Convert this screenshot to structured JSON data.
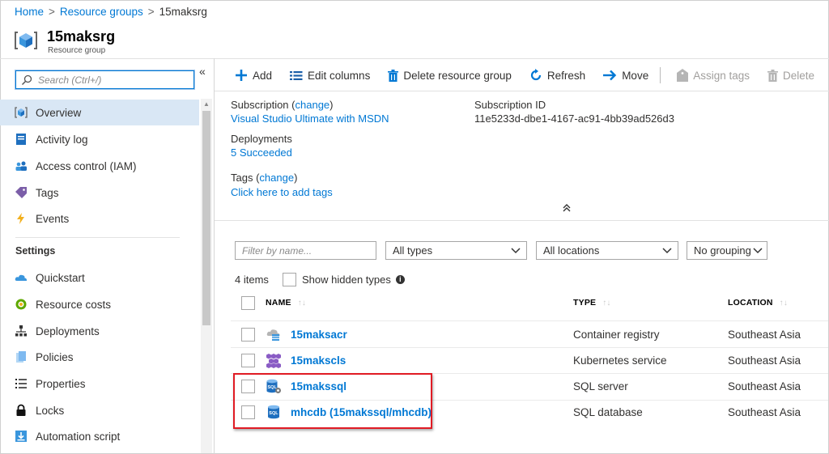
{
  "breadcrumb": [
    "Home",
    "Resource groups",
    "15maksrg"
  ],
  "resource_group": {
    "name": "15maksrg",
    "subtitle": "Resource group"
  },
  "sidebar": {
    "search_placeholder": "Search (Ctrl+/)",
    "collapse_glyph": "«",
    "items": [
      {
        "label": "Overview",
        "icon": "resource-group-icon",
        "active": true
      },
      {
        "label": "Activity log",
        "icon": "activity-log-icon"
      },
      {
        "label": "Access control (IAM)",
        "icon": "users-icon"
      },
      {
        "label": "Tags",
        "icon": "tag-icon"
      },
      {
        "label": "Events",
        "icon": "lightning-icon"
      }
    ],
    "section_title": "Settings",
    "settings_items": [
      {
        "label": "Quickstart",
        "icon": "cloud-icon"
      },
      {
        "label": "Resource costs",
        "icon": "coin-icon"
      },
      {
        "label": "Deployments",
        "icon": "deploy-icon"
      },
      {
        "label": "Policies",
        "icon": "policy-icon"
      },
      {
        "label": "Properties",
        "icon": "list-icon"
      },
      {
        "label": "Locks",
        "icon": "lock-icon"
      },
      {
        "label": "Automation script",
        "icon": "download-icon"
      }
    ]
  },
  "toolbar": {
    "add": "Add",
    "edit_columns": "Edit columns",
    "delete_group": "Delete resource group",
    "refresh": "Refresh",
    "move": "Move",
    "assign_tags": "Assign tags",
    "delete": "Delete"
  },
  "essentials": {
    "subscription_label": "Subscription",
    "change": "change",
    "subscription_value": "Visual Studio Ultimate with MSDN",
    "subscription_id_label": "Subscription ID",
    "subscription_id": "11e5233d-dbe1-4167-ac91-4bb39ad526d3",
    "deployments_label": "Deployments",
    "deployments_value": "5 Succeeded",
    "tags_label": "Tags",
    "tags_link": "Click here to add tags"
  },
  "filters": {
    "name_placeholder": "Filter by name...",
    "types": "All types",
    "locations": "All locations",
    "grouping": "No grouping"
  },
  "list": {
    "count": "4 items",
    "show_hidden": "Show hidden types",
    "columns": {
      "name": "NAME",
      "type": "TYPE",
      "location": "LOCATION"
    },
    "rows": [
      {
        "name": "15maksacr",
        "type": "Container registry",
        "location": "Southeast Asia",
        "icon": "container-registry-icon"
      },
      {
        "name": "15makscls",
        "type": "Kubernetes service",
        "location": "Southeast Asia",
        "icon": "kubernetes-icon"
      },
      {
        "name": "15makssql",
        "type": "SQL server",
        "location": "Southeast Asia",
        "icon": "sql-server-icon"
      },
      {
        "name": "mhcdb (15makssql/mhcdb)",
        "type": "SQL database",
        "location": "Southeast Asia",
        "icon": "sql-database-icon"
      }
    ]
  },
  "colors": {
    "accent": "#0078d4",
    "highlight": "#e01b24",
    "active_nav": "#d9e7f5"
  }
}
